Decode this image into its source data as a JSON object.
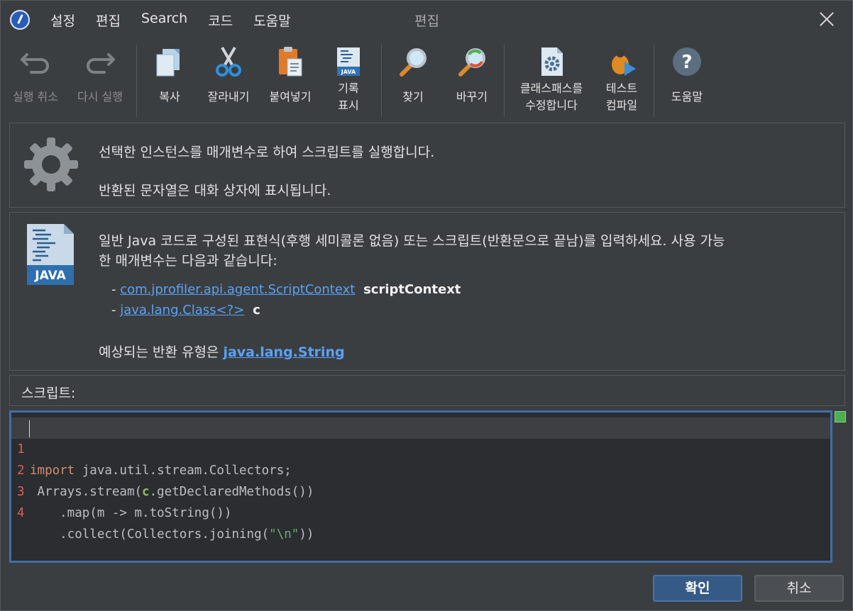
{
  "titlebar": {
    "menu": [
      "설정",
      "편집",
      "Search",
      "코드",
      "도움말"
    ],
    "title": "편집"
  },
  "toolbar": {
    "undo": "실행 취소",
    "redo": "다시 실행",
    "copy": "복사",
    "cut": "잘라내기",
    "paste": "붙여넣기",
    "history_line1": "기록",
    "history_line2": "표시",
    "find": "찾기",
    "replace": "바꾸기",
    "classpath_line1": "클래스패스를",
    "classpath_line2": "수정합니다",
    "test_line1": "테스트",
    "test_line2": "컴파일",
    "help": "도움말"
  },
  "info": {
    "line1": "선택한 인스턴스를 매개변수로 하여 스크립트를 실행합니다.",
    "line2": "반환된 문자열은 대화 상자에 표시됩니다."
  },
  "java_icon_label": "JAVA",
  "desc": {
    "line1": "일반 Java 코드로 구성된 표현식(후행 세미콜론 없음) 또는 스크립트(반환문으로 끝남)를 입력하세요. 사용 가능",
    "line2": "한 매개변수는 다음과 같습니다:",
    "params": [
      {
        "type": "com.jprofiler.api.agent.ScriptContext",
        "name": "scriptContext"
      },
      {
        "type": "java.lang.Class<?>",
        "name": "c"
      }
    ],
    "return_prefix": "예상되는 반환 유형은",
    "return_type": "java.lang.String"
  },
  "script_label": "스크립트:",
  "editor": {
    "lines": [
      {
        "num": "1",
        "kw": "import",
        "rest": " java.util.stream.Collectors;"
      },
      {
        "num": "2",
        "pre": " Arrays.stream(",
        "var": "c",
        "post": ".getDeclaredMethods())"
      },
      {
        "num": "3",
        "text": "    .map(m -> m.toString())"
      },
      {
        "num": "4",
        "pre": "    .collect(Collectors.joining(",
        "str": "\"\\n\"",
        "post": "))"
      }
    ]
  },
  "buttons": {
    "ok": "확인",
    "cancel": "취소"
  }
}
